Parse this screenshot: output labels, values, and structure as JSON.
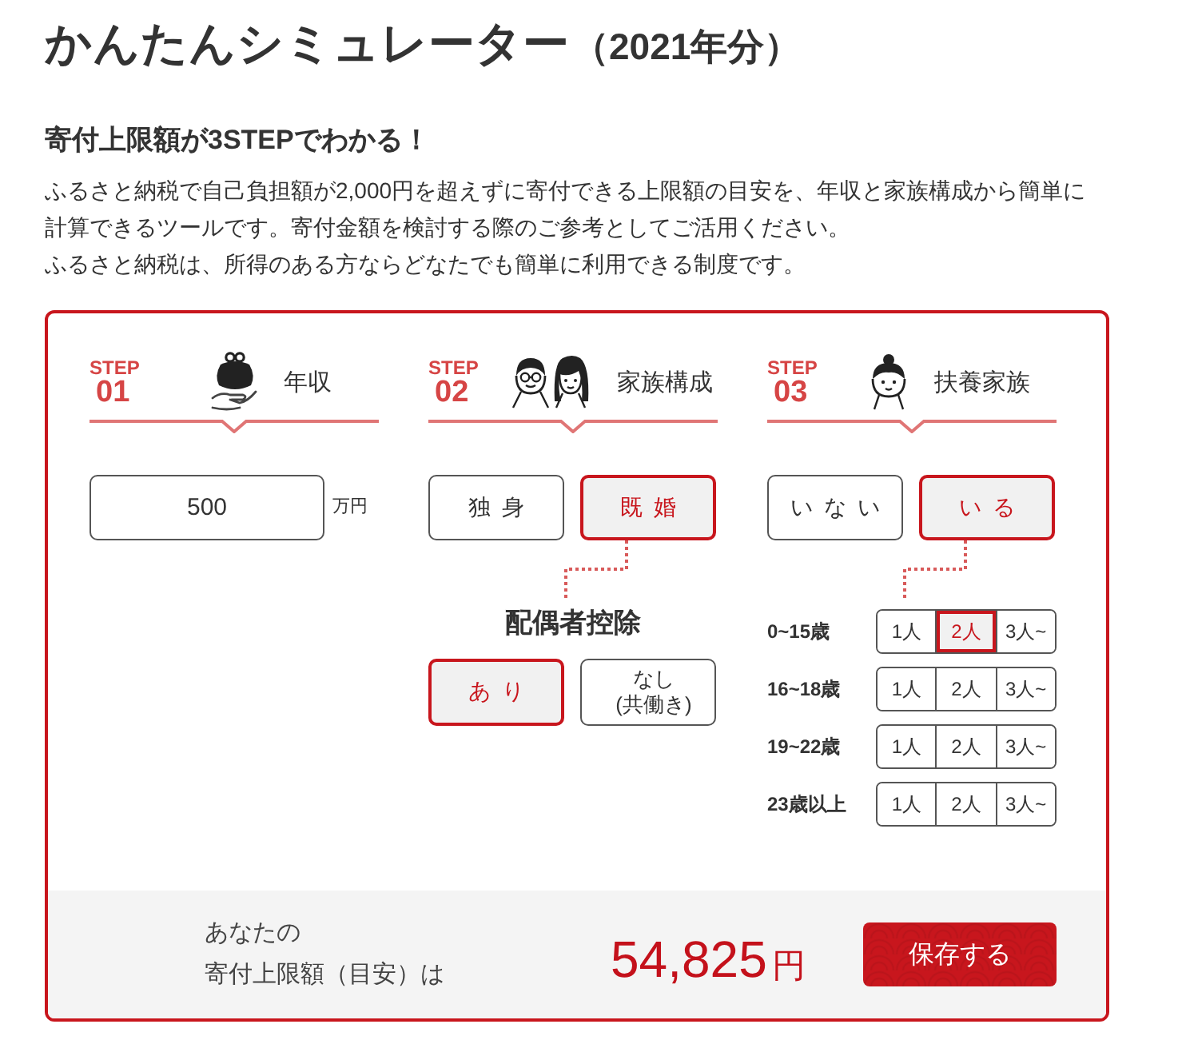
{
  "title": {
    "main": "かんたんシミュレーター",
    "year": "（2021年分）"
  },
  "subtitle": "寄付上限額が3STEPでわかる！",
  "description": [
    "ふるさと納税で自己負担額が2,000円を超えずに寄付できる上限額の目安を、年収と家族構成から簡単に計算できるツールです。寄付金額を検討する際のご参考としてご活用ください。",
    "ふるさと納税は、所得のある方ならどなたでも簡単に利用できる制度です。"
  ],
  "steps": [
    {
      "kind": "income",
      "step_label": "STEP",
      "step_number": "01",
      "title": "年収",
      "input": {
        "value": "500"
      },
      "unit": "万円"
    },
    {
      "kind": "family",
      "step_label": "STEP",
      "step_number": "02",
      "title": "家族構成",
      "options": [
        {
          "label": "独身",
          "selected": false
        },
        {
          "label": "既婚",
          "selected": true
        }
      ],
      "spouse_deduction": {
        "title": "配偶者控除",
        "options": [
          {
            "label": "あり",
            "selected": true
          },
          {
            "label": "なし",
            "note": "(共働き)",
            "selected": false
          }
        ]
      }
    },
    {
      "kind": "dependents",
      "step_label": "STEP",
      "step_number": "03",
      "title": "扶養家族",
      "options": [
        {
          "label": "いない",
          "selected": false
        },
        {
          "label": "いる",
          "selected": true
        }
      ],
      "age_groups": [
        {
          "label": "0~15歳",
          "options": [
            {
              "label": "1人",
              "selected": false
            },
            {
              "label": "2人",
              "selected": true
            },
            {
              "label": "3人~",
              "selected": false
            }
          ]
        },
        {
          "label": "16~18歳",
          "options": [
            {
              "label": "1人",
              "selected": false
            },
            {
              "label": "2人",
              "selected": false
            },
            {
              "label": "3人~",
              "selected": false
            }
          ]
        },
        {
          "label": "19~22歳",
          "options": [
            {
              "label": "1人",
              "selected": false
            },
            {
              "label": "2人",
              "selected": false
            },
            {
              "label": "3人~",
              "selected": false
            }
          ]
        },
        {
          "label": "23歳以上",
          "options": [
            {
              "label": "1人",
              "selected": false
            },
            {
              "label": "2人",
              "selected": false
            },
            {
              "label": "3人~",
              "selected": false
            }
          ]
        }
      ]
    }
  ],
  "result": {
    "label_lines": [
      "あなたの",
      "寄付上限額（目安）は"
    ],
    "amount": "54,825",
    "unit": "円"
  },
  "save_button": "保存する"
}
